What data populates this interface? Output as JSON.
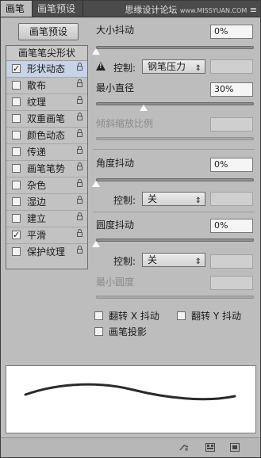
{
  "tabs": [
    {
      "label": "画笔"
    },
    {
      "label": "画笔预设"
    }
  ],
  "watermark": {
    "text": "思缘设计论坛",
    "url": "www.MISSYUAN.COM",
    "menu": "≡"
  },
  "preset_button": {
    "label": "画笔预设"
  },
  "options": {
    "header": "画笔笔尖形状",
    "items": [
      {
        "label": "形状动态",
        "checked": "✓"
      },
      {
        "label": "散布",
        "checked": ""
      },
      {
        "label": "纹理",
        "checked": ""
      },
      {
        "label": "双重画笔",
        "checked": ""
      },
      {
        "label": "颜色动态",
        "checked": ""
      },
      {
        "label": "传递",
        "checked": ""
      },
      {
        "label": "画笔笔势",
        "checked": ""
      },
      {
        "label": "杂色",
        "checked": ""
      },
      {
        "label": "湿边",
        "checked": ""
      },
      {
        "label": "建立",
        "checked": ""
      },
      {
        "label": "平滑",
        "checked": "✓"
      },
      {
        "label": "保护纹理",
        "checked": ""
      }
    ]
  },
  "size_jitter": {
    "label": "大小抖动",
    "value": "0%"
  },
  "control1": {
    "label": "控制:",
    "value": "钢笔压力",
    "arrow": "⇕"
  },
  "min_diameter": {
    "label": "最小直径",
    "value": "30%"
  },
  "tilt_scale": {
    "label": "倾斜缩放比例"
  },
  "angle_jitter": {
    "label": "角度抖动",
    "value": "0%"
  },
  "control2": {
    "label": "控制:",
    "value": "关",
    "arrow": "⇕"
  },
  "roundness_jitter": {
    "label": "圆度抖动",
    "value": "0%"
  },
  "control3": {
    "label": "控制:",
    "value": "关",
    "arrow": "⇕"
  },
  "min_roundness": {
    "label": "最小圆度"
  },
  "flip_x": {
    "label": "翻转 X 抖动"
  },
  "flip_y": {
    "label": "翻转 Y 抖动"
  },
  "brush_projection": {
    "label": "画笔投影"
  },
  "colors": {
    "panel": "#bdbdbd",
    "tab_bar": "#4b4b4b",
    "selected_row": "#c7d3e6"
  }
}
